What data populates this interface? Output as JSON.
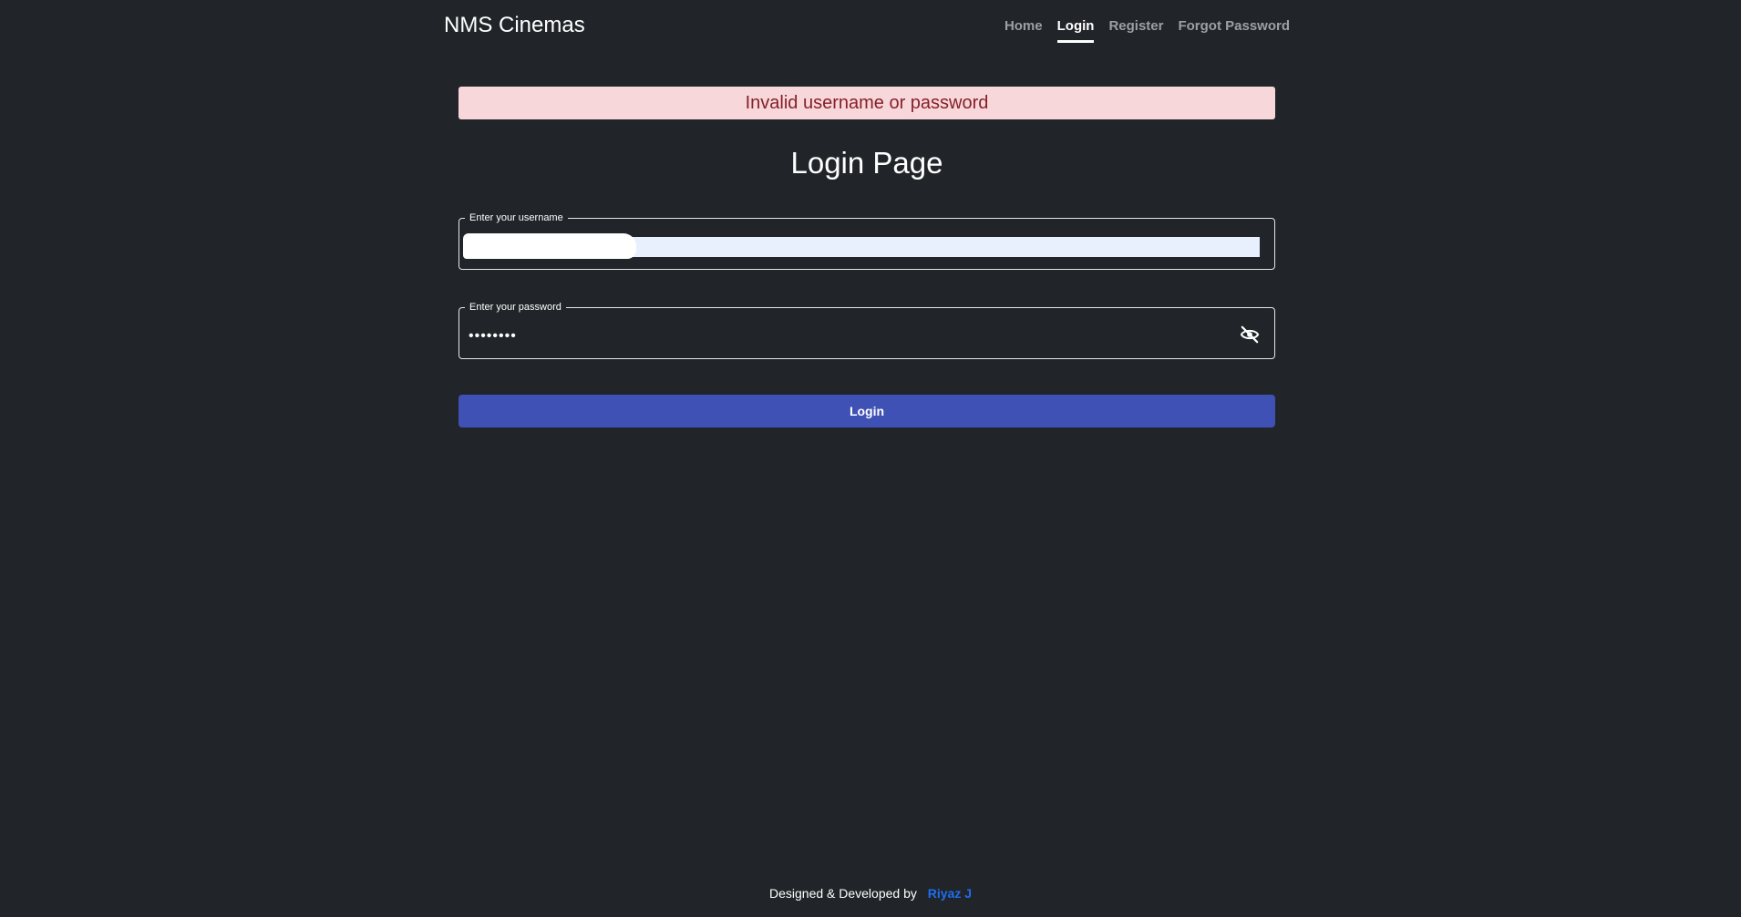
{
  "header": {
    "brand": "NMS Cinemas",
    "nav": {
      "home": "Home",
      "login": "Login",
      "register": "Register",
      "forgot_password": "Forgot Password"
    },
    "active_nav": "login"
  },
  "alert": {
    "message": "Invalid username or password",
    "background_color": "#f8d7da",
    "text_color": "#842029"
  },
  "main": {
    "title": "Login Page",
    "username": {
      "label": "Enter your username",
      "value": ""
    },
    "password": {
      "label": "Enter your password",
      "value": "••••••••",
      "toggle_icon": "eye-off-icon"
    },
    "login_button": "Login",
    "accent_color": "#3f51b5"
  },
  "footer": {
    "text": "Designed & Developed by",
    "author": "Riyaz J",
    "author_color": "#1e6df0"
  }
}
